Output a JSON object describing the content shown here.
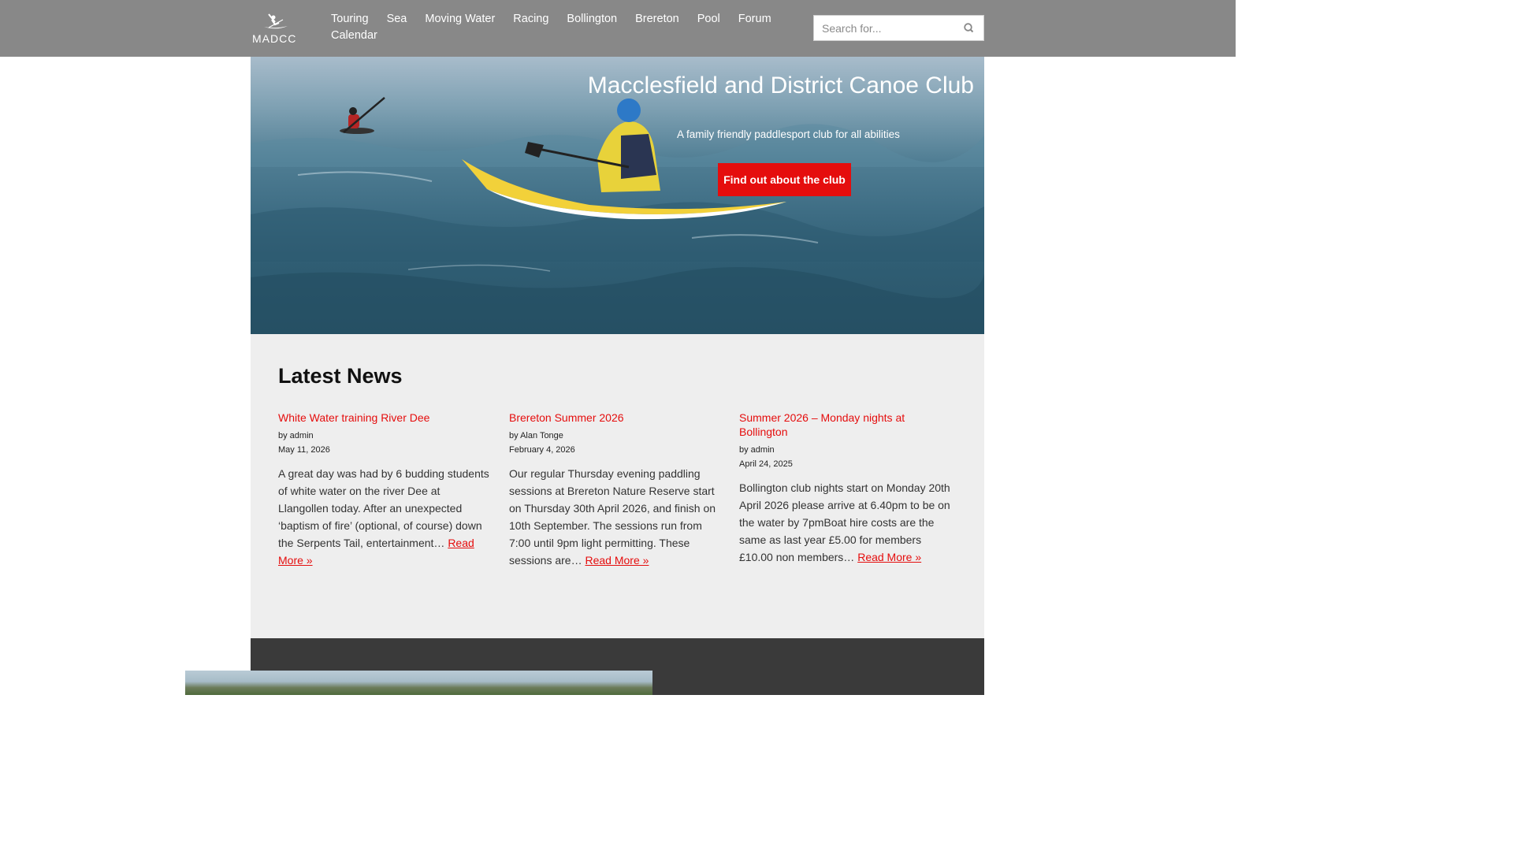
{
  "header": {
    "logo_text": "MADCC",
    "nav": [
      "Touring",
      "Sea",
      "Moving Water",
      "Racing",
      "Bollington",
      "Brereton",
      "Pool",
      "Forum",
      "Calendar"
    ],
    "search_placeholder": "Search for..."
  },
  "hero": {
    "title": "Macclesfield and District Canoe Club",
    "subtitle": "A family friendly paddlesport club for all abilities",
    "button": "Find out about the club"
  },
  "news": {
    "heading": "Latest News",
    "posts": [
      {
        "title": "White Water training River Dee",
        "author": "by admin",
        "date": "May 11, 2026",
        "excerpt": "A great day was had by 6 budding students of white water on the river Dee at Llangollen today. After an unexpected ‘baptism of fire’ (optional, of course) down the Serpents Tail, entertainment…",
        "read_more": "Read More »"
      },
      {
        "title": "Brereton Summer 2026",
        "author": "by Alan Tonge",
        "date": "February 4, 2026",
        "excerpt": "Our regular Thursday evening paddling sessions at Brereton Nature Reserve start on Thursday 30th April 2026, and finish on 10th September. The sessions run from 7:00 until 9pm light permitting. These sessions are…",
        "read_more": "Read More »"
      },
      {
        "title": "Summer 2026 – Monday nights at Bollington",
        "author": "by admin",
        "date": "April 24, 2025",
        "excerpt": "Bollington club nights start on Monday 20th April 2026 please arrive at 6.40pm to be on the water by 7pmBoat hire costs are the same as last year £5.00 for members £10.00 non members…",
        "read_more": "Read More »"
      }
    ]
  },
  "colors": {
    "header_bg": "#888888",
    "accent_red": "#e50d0d",
    "news_bg": "#eeeeee",
    "footer_bg": "#3a3a3a"
  }
}
